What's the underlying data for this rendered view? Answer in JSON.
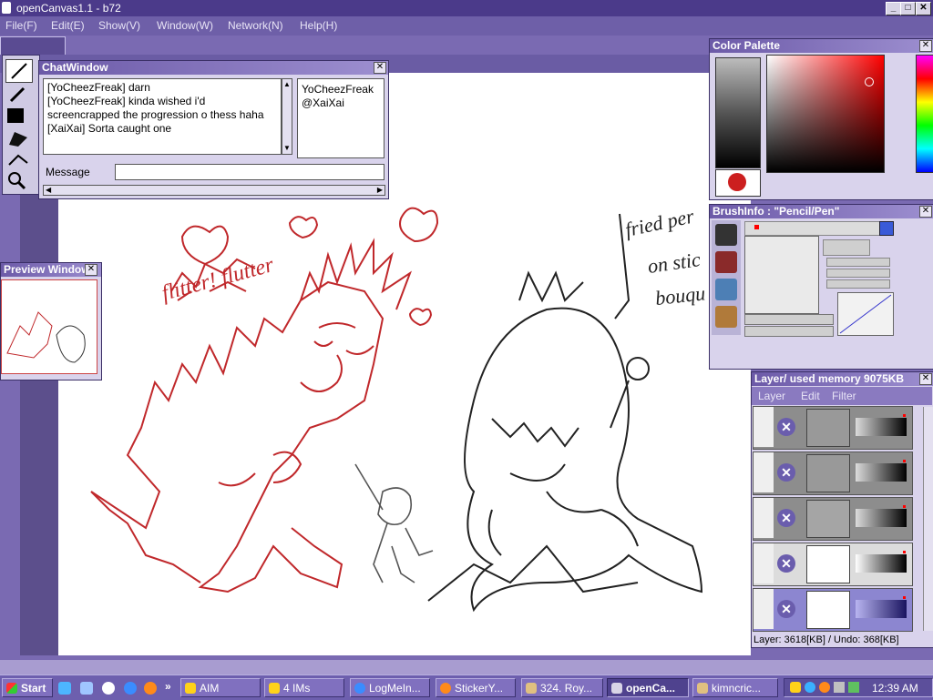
{
  "app": {
    "title": "openCanvas1.1 - b72"
  },
  "menu": [
    "File(F)",
    "Edit(E)",
    "Show(V)",
    "Window(W)",
    "Network(N)",
    "Help(H)"
  ],
  "chat_window": {
    "title": "ChatWindow",
    "messages": [
      "[YoCheezFreak] darn",
      "[YoCheezFreak] kinda wished i'd",
      "screencrapped the progression o thess haha",
      "[XaiXai] Sorta caught one"
    ],
    "users": [
      "YoCheezFreak",
      "@XaiXai"
    ],
    "message_label": "Message",
    "message_value": ""
  },
  "preview_window": {
    "title": "Preview Window"
  },
  "color_palette": {
    "title": "Color Palette",
    "current_color": "#cc1f1f"
  },
  "brush_info": {
    "title": "BrushInfo : \"Pencil/Pen\""
  },
  "layer_panel": {
    "title": "Layer/ used memory 9075KB",
    "menu": [
      "Layer",
      "Edit",
      "Filter"
    ],
    "status": "Layer: 3618[KB] / Undo: 368[KB]"
  },
  "canvas_text": {
    "red_note": "flitter! flutter",
    "black_note_1": "fried per",
    "black_note_2": "on stic",
    "black_note_3": "bouqu"
  },
  "taskbar": {
    "start_label": "Start",
    "buttons": [
      "AIM",
      "4 IMs",
      "LogMeIn...",
      "StickerY...",
      "324. Roy...",
      "openCa...",
      "kimncric..."
    ],
    "active_index": 5,
    "clock": "12:39 AM"
  },
  "colors": {
    "accent": "#4b3a8a",
    "workspace": "#7a6ab2",
    "stroke_red": "#c0282b"
  }
}
